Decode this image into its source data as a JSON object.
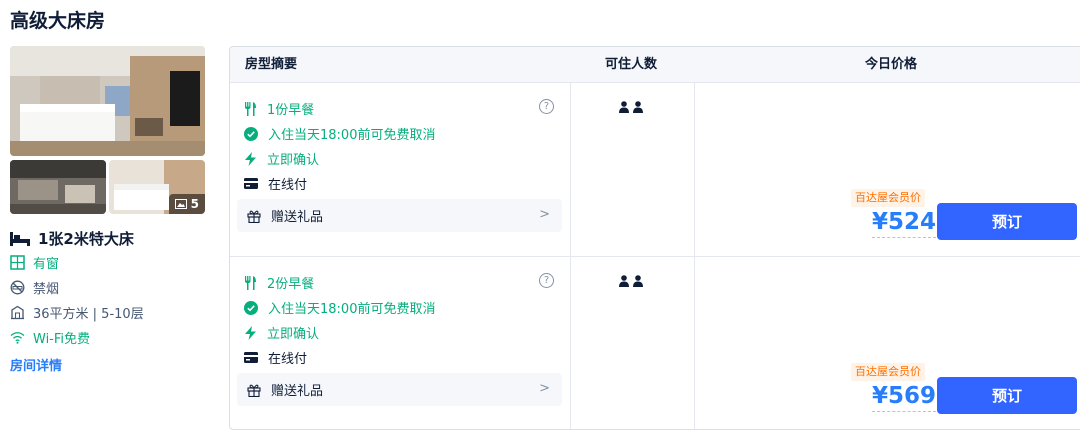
{
  "room": {
    "title": "高级大床房",
    "photo_count": "5",
    "bed": "1张2米特大床",
    "features": [
      {
        "icon": "window-icon",
        "label": "有窗"
      },
      {
        "icon": "no-smoking-icon",
        "label": "禁烟"
      },
      {
        "icon": "area-icon",
        "label": "36平方米 | 5-10层"
      },
      {
        "icon": "wifi-icon",
        "label": "Wi-Fi免费"
      }
    ],
    "details_link": "房间详情"
  },
  "table": {
    "headers": {
      "summary": "房型摘要",
      "occupancy": "可住人数",
      "price": "今日价格"
    },
    "rows": [
      {
        "breakfast": "1份早餐",
        "cancel": "入住当天18:00前可免费取消",
        "confirm": "立即确认",
        "payment": "在线付",
        "gift": "赠送礼品",
        "occupancy": 2,
        "member_tag": "百达屋会员价",
        "price": "¥524",
        "book": "预订"
      },
      {
        "breakfast": "2份早餐",
        "cancel": "入住当天18:00前可免费取消",
        "confirm": "立即确认",
        "payment": "在线付",
        "gift": "赠送礼品",
        "occupancy": 2,
        "member_tag": "百达屋会员价",
        "price": "¥569",
        "book": "预订"
      }
    ]
  },
  "colors": {
    "green": "#06ae7d",
    "blue": "#287dfa",
    "button": "#3264ff",
    "orange": "#ff6f00"
  }
}
